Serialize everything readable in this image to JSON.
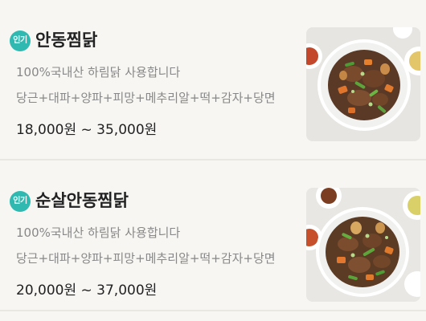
{
  "menu": {
    "items": [
      {
        "badge": "인기",
        "name": "안동찜닭",
        "description": "100%국내산 하림닭 사용합니다",
        "ingredients": "당근+대파+양파+피망+메추리알+떡+감자+당면",
        "price": "18,000원 ~ 35,000원",
        "image_icon": "braised-chicken-photo"
      },
      {
        "badge": "인기",
        "name": "순살안동찜닭",
        "description": "100%국내산 하림닭 사용합니다",
        "ingredients": "당근+대파+양파+피망+메추리알+떡+감자+당면",
        "price": "20,000원 ~ 37,000원",
        "image_icon": "boneless-braised-chicken-photo"
      }
    ]
  },
  "colors": {
    "badge": "#2fb9b0",
    "background": "#f7f6f3",
    "muted_text": "#888888"
  }
}
